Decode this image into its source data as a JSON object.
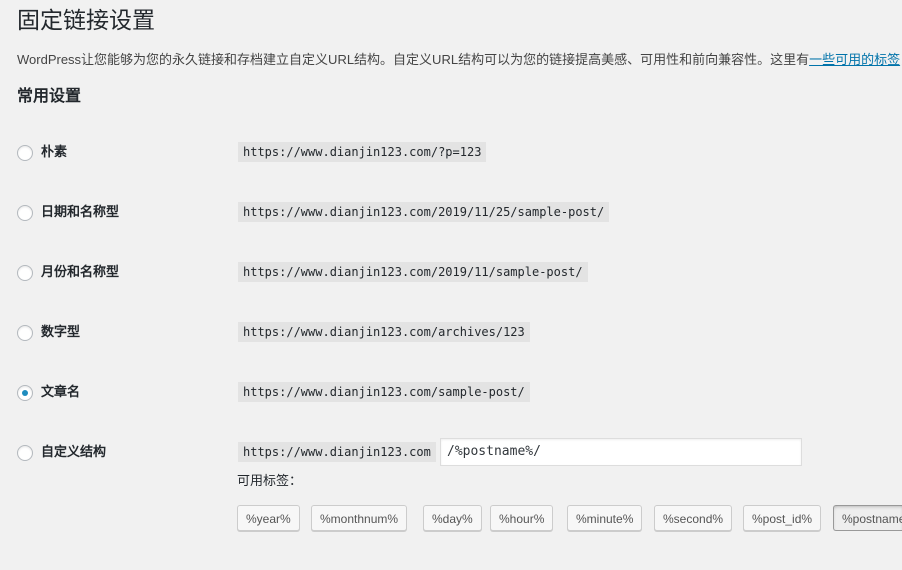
{
  "page": {
    "title": "固定链接设置",
    "intro_text": "WordPress让您能够为您的永久链接和存档建立自定义URL结构。自定义URL结构可以为您的链接提高美感、可用性和前向兼容性。这里有",
    "intro_link": "一些可用的标签",
    "intro_suffix": "，"
  },
  "common_settings": {
    "title": "常用设置",
    "options": [
      {
        "label": "朴素",
        "example": "https://www.dianjin123.com/?p=123",
        "checked": false
      },
      {
        "label": "日期和名称型",
        "example": "https://www.dianjin123.com/2019/11/25/sample-post/",
        "checked": false
      },
      {
        "label": "月份和名称型",
        "example": "https://www.dianjin123.com/2019/11/sample-post/",
        "checked": false
      },
      {
        "label": "数字型",
        "example": "https://www.dianjin123.com/archives/123",
        "checked": false
      },
      {
        "label": "文章名",
        "example": "https://www.dianjin123.com/sample-post/",
        "checked": true
      },
      {
        "label": "自定义结构",
        "example": "https://www.dianjin123.com",
        "checked": false
      }
    ],
    "custom_structure_value": "/%postname%/",
    "available_tags_label": "可用标签：",
    "tags": [
      "%year%",
      "%monthnum%",
      "%day%",
      "%hour%",
      "%minute%",
      "%second%",
      "%post_id%",
      "%postname%"
    ]
  }
}
